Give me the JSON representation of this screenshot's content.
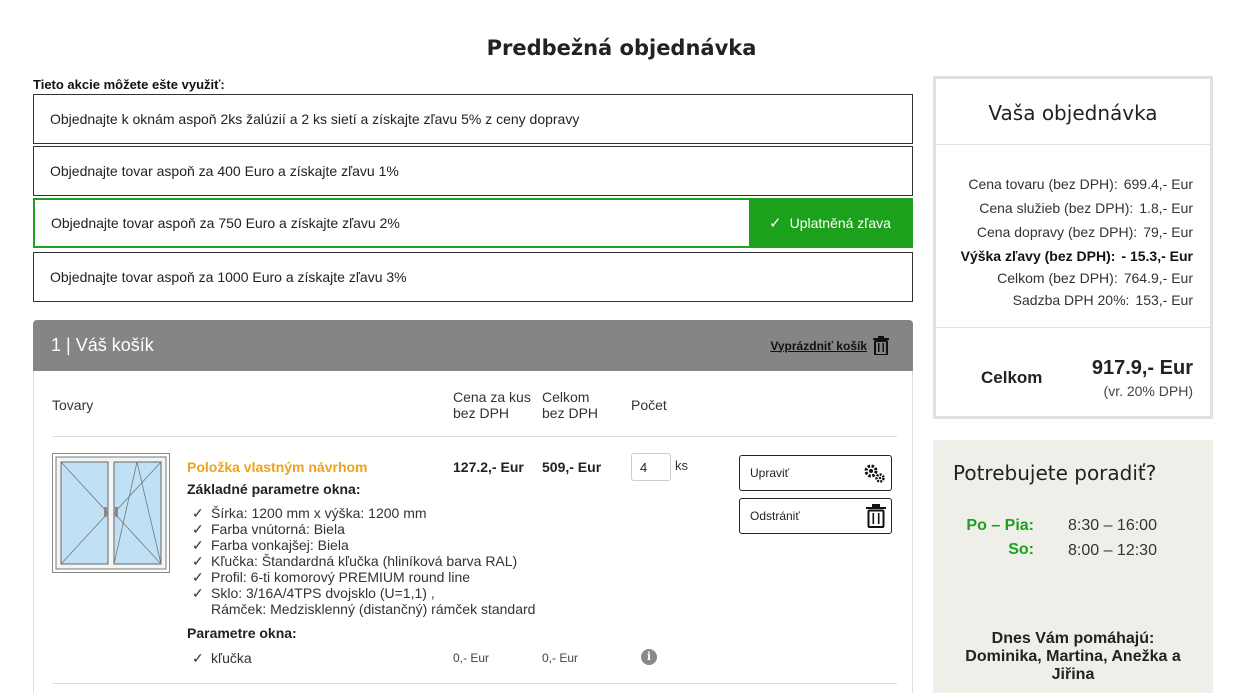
{
  "page": {
    "title": "Predbežná objednávka"
  },
  "actions": {
    "label": "Tieto akcie môžete ešte využiť:",
    "items": [
      {
        "text": "Objednajte k oknám aspoň 2ks žalúzií a 2 ks sietí a získajte zľavu 5% z ceny dopravy"
      },
      {
        "text": "Objednajte tovar aspoň za 400 Euro a získajte zľavu 1%"
      },
      {
        "text": "Objednajte tovar aspoň za 750 Euro a získajte zľavu 2%",
        "badge": "Uplatněná zľava"
      },
      {
        "text": "Objednajte tovar aspoň za 1000 Euro a získajte zľavu 3%"
      }
    ]
  },
  "cart": {
    "title": "1 | Váš košík",
    "empty_label": "Vyprázdniť košík",
    "headers": {
      "goods": "Tovary",
      "unit_price_1": "Cena za kus",
      "unit_price_2": "bez DPH",
      "total_1": "Celkom",
      "total_2": "bez DPH",
      "count": "Počet"
    },
    "item": {
      "name": "Položka vlastným návrhom",
      "unit_price": "127.2,- Eur",
      "total": "509,- Eur",
      "quantity": "4",
      "unit": "ks",
      "edit_label": "Upraviť",
      "remove_label": "Odstrániť",
      "basic_params_title": "Základné parametre okna:",
      "basic_params": [
        "Šírka: 1200 mm x výška: 1200 mm",
        "Farba vnútorná: Biela",
        "Farba vonkajšej: Biela",
        "Kľučka: Štandardná kľučka (hliníková barva RAL)",
        "Profil: 6-ti komorový PREMIUM round line",
        "Sklo: 3/16A/4TPS dvojsklo (U=1,1) ,",
        "Rámček: Medzisklenný (distančný) rámček standard"
      ],
      "params_title": "Parametre okna:",
      "params": [
        {
          "name": "kľučka",
          "unit_price": "0,- Eur",
          "total": "0,- Eur"
        }
      ]
    }
  },
  "summary": {
    "title": "Vaša objednávka",
    "rows": [
      {
        "label": "Cena tovaru (bez DPH):",
        "value": "699.4,- Eur"
      },
      {
        "label": "Cena služieb (bez DPH):",
        "value": "1.8,- Eur"
      },
      {
        "label": "Cena dopravy (bez DPH):",
        "value": "79,- Eur"
      },
      {
        "label": "Výška zľavy (bez DPH):",
        "value": "- 15.3,- Eur"
      },
      {
        "label": "Celkom (bez DPH):",
        "value": "764.9,- Eur"
      },
      {
        "label": "Sadzba DPH 20%:",
        "value": "153,- Eur"
      }
    ],
    "total_label": "Celkom",
    "total_value": "917.9,- Eur",
    "total_note": "(vr. 20% DPH)"
  },
  "help": {
    "title": "Potrebujete poradiť?",
    "hours": [
      {
        "days": "Po – Pia:",
        "time": "8:30 – 16:00"
      },
      {
        "days": "So:",
        "time": "8:00 – 12:30"
      }
    ],
    "today": "Dnes Vám pomáhajú: Dominika, Martina, Anežka a Jiřina"
  },
  "colors": {
    "accent_green": "#1ba11b",
    "item_orange": "#f0a21c",
    "cart_header_gray": "#858585"
  }
}
